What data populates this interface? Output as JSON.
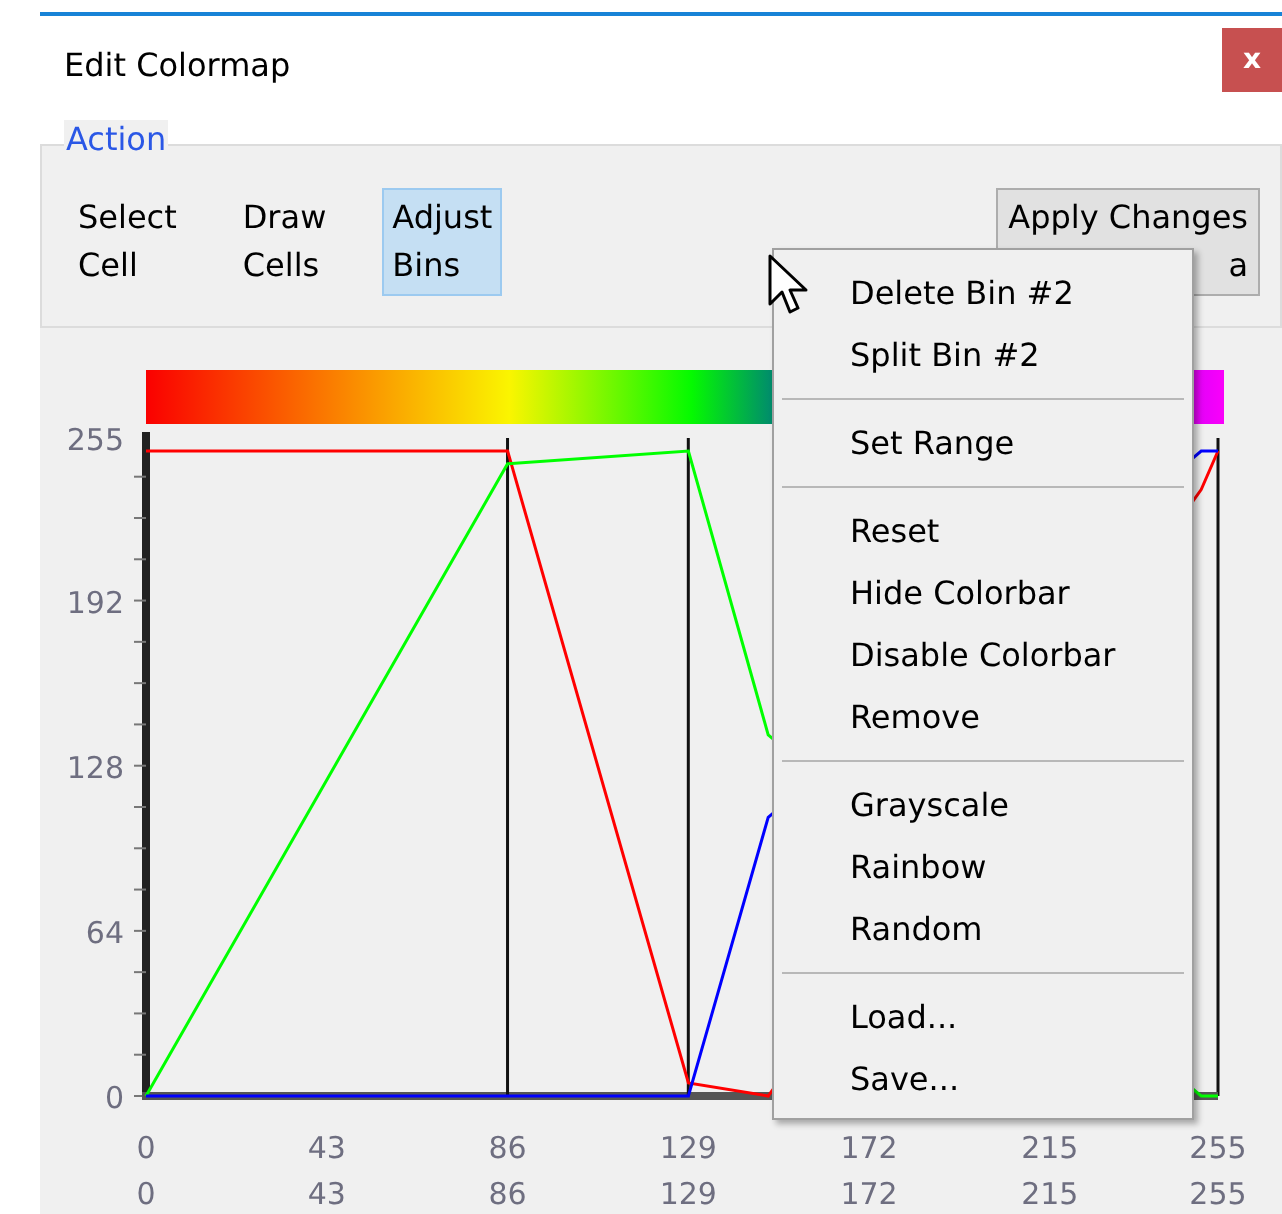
{
  "window": {
    "title": "Edit Colormap",
    "close_label": "x"
  },
  "action_group": {
    "label": "Action",
    "tools": [
      {
        "lines": [
          "Select",
          "Cell"
        ],
        "selected": false
      },
      {
        "lines": [
          "Draw",
          "Cells"
        ],
        "selected": false
      },
      {
        "lines": [
          "Adjust",
          "Bins"
        ],
        "selected": true
      }
    ],
    "apply_button": {
      "lines": [
        "Apply Changes",
        "a"
      ]
    }
  },
  "chart_data": {
    "type": "line",
    "x": [
      0,
      86,
      129,
      148,
      251,
      255
    ],
    "series": [
      {
        "color": "#ff0000",
        "values": [
          250,
          250,
          5,
          0,
          235,
          250
        ]
      },
      {
        "color": "#00ff00",
        "values": [
          0,
          245,
          250,
          140,
          0,
          0
        ]
      },
      {
        "color": "#0000ff",
        "values": [
          0,
          0,
          0,
          108,
          250,
          250
        ]
      }
    ],
    "ref_lines": [
      {
        "axis": "x",
        "value": 86
      },
      {
        "axis": "x",
        "value": 129
      }
    ],
    "xlim": [
      0,
      255
    ],
    "ylim": [
      0,
      255
    ],
    "xticks": [
      0,
      43,
      86,
      129,
      172,
      215,
      255
    ],
    "yticks": [
      0,
      64,
      128,
      192,
      255
    ]
  },
  "secondary_x_labels": [
    "0",
    "43",
    "86",
    "129",
    "172",
    "215",
    "255"
  ],
  "context_menu": [
    {
      "kind": "item",
      "label": "Delete Bin #2"
    },
    {
      "kind": "item",
      "label": "Split Bin #2"
    },
    {
      "kind": "separator"
    },
    {
      "kind": "item",
      "label": "Set Range"
    },
    {
      "kind": "separator"
    },
    {
      "kind": "item",
      "label": "Reset"
    },
    {
      "kind": "item",
      "label": "Hide Colorbar"
    },
    {
      "kind": "item",
      "label": "Disable Colorbar"
    },
    {
      "kind": "item",
      "label": "Remove"
    },
    {
      "kind": "separator"
    },
    {
      "kind": "item",
      "label": "Grayscale"
    },
    {
      "kind": "item",
      "label": "Rainbow"
    },
    {
      "kind": "item",
      "label": "Random"
    },
    {
      "kind": "separator"
    },
    {
      "kind": "item",
      "label": "Load..."
    },
    {
      "kind": "item",
      "label": "Save..."
    }
  ]
}
